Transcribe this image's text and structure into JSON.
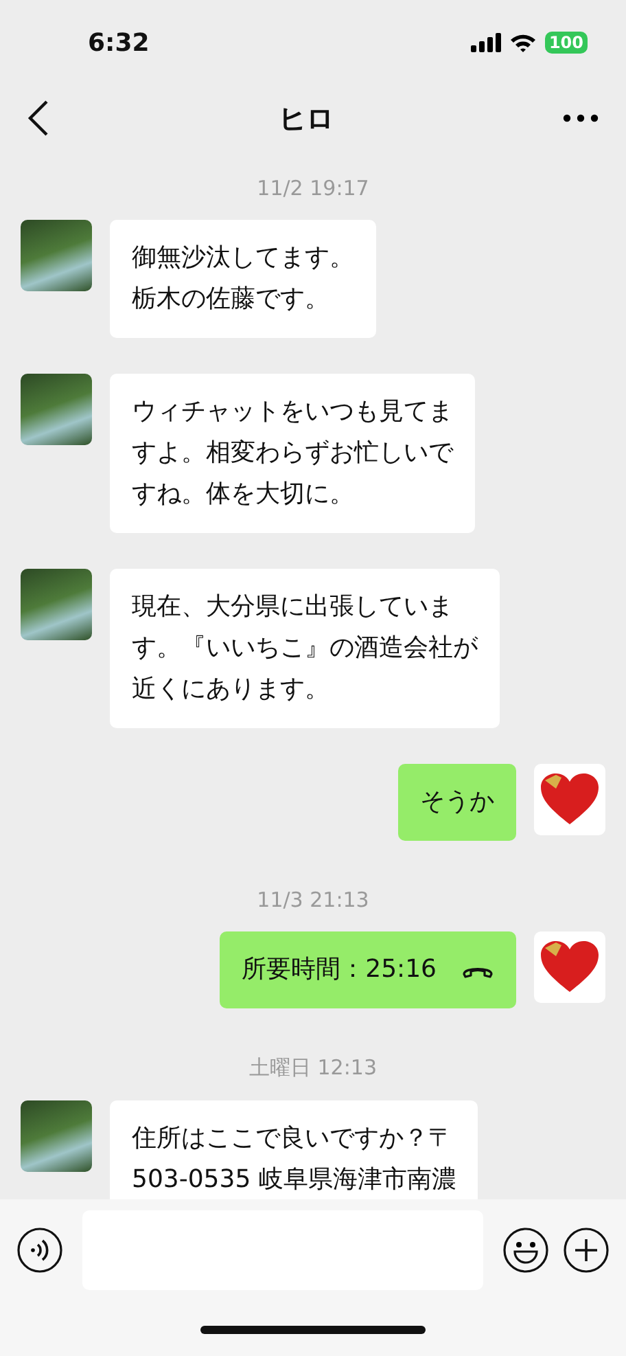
{
  "status_bar": {
    "time": "6:32",
    "battery": "100"
  },
  "header": {
    "title": "ヒロ"
  },
  "messages": [
    {
      "kind": "time",
      "text": "11/2 19:17"
    },
    {
      "kind": "text",
      "outgoing": false,
      "lines": [
        "御無沙汰してます。",
        "栃木の佐藤です。"
      ]
    },
    {
      "kind": "text",
      "outgoing": false,
      "lines": [
        "ウィチャットをいつも見てま",
        "すよ。相変わらずお忙しいで",
        "すね。体を大切に。"
      ]
    },
    {
      "kind": "text",
      "outgoing": false,
      "lines": [
        "現在、大分県に出張していま",
        "す。『いいちこ』の酒造会社が",
        "近くにあります。"
      ]
    },
    {
      "kind": "text",
      "outgoing": true,
      "lines": [
        "そうか"
      ]
    },
    {
      "kind": "time",
      "text": "11/3 21:13"
    },
    {
      "kind": "call",
      "outgoing": true,
      "lines": [
        "所要時間：25:16"
      ]
    },
    {
      "kind": "time",
      "text": "土曜日 12:13"
    },
    {
      "kind": "text",
      "outgoing": false,
      "lines": [
        "住所はここで良いですか？〒",
        "503-0535 岐阜県海津市南濃"
      ]
    }
  ]
}
